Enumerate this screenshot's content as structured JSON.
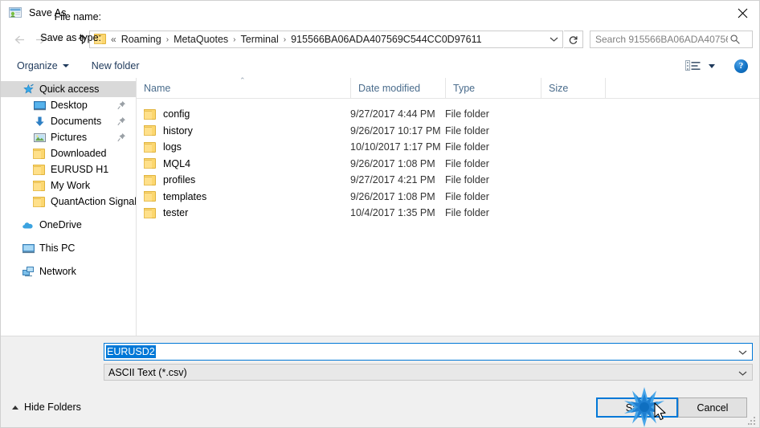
{
  "window": {
    "title": "Save As",
    "app_icon": "save-as-app-icon",
    "close_label": "✕"
  },
  "navigation": {
    "back_icon": "arrow-left-icon",
    "forward_icon": "arrow-right-icon",
    "recent_icon": "chevron-down-icon",
    "up_icon": "arrow-up-icon",
    "address": {
      "folder_icon": "folder-icon",
      "overflow": "«",
      "crumbs": [
        "Roaming",
        "MetaQuotes",
        "Terminal",
        "915566BA06ADA407569C544CC0D97611"
      ],
      "separator": "›",
      "dropdown_icon": "chevron-down-icon"
    },
    "refresh_icon": "refresh-icon",
    "search": {
      "placeholder": "Search 915566BA06ADA40756...",
      "value": "",
      "icon": "search-icon"
    }
  },
  "toolbar": {
    "organize_label": "Organize",
    "new_folder_label": "New folder",
    "view_icon": "list-view-icon",
    "view_dropdown_icon": "chevron-down-icon",
    "help_label": "?",
    "help_icon": "help-icon"
  },
  "sidebar": {
    "items": [
      {
        "label": "Quick access",
        "icon": "star-pin-icon",
        "level": 0,
        "selected": true,
        "pinned": false
      },
      {
        "label": "Desktop",
        "icon": "desktop-icon",
        "level": 1,
        "selected": false,
        "pinned": true
      },
      {
        "label": "Documents",
        "icon": "download-arrow-icon",
        "level": 1,
        "selected": false,
        "pinned": true
      },
      {
        "label": "Pictures",
        "icon": "pictures-icon",
        "level": 1,
        "selected": false,
        "pinned": true
      },
      {
        "label": "Downloaded",
        "icon": "folder-icon",
        "level": 1,
        "selected": false,
        "pinned": false
      },
      {
        "label": "EURUSD H1",
        "icon": "folder-icon",
        "level": 1,
        "selected": false,
        "pinned": false
      },
      {
        "label": "My Work",
        "icon": "folder-icon",
        "level": 1,
        "selected": false,
        "pinned": false
      },
      {
        "label": "QuantAction Signal",
        "icon": "folder-icon",
        "level": 1,
        "selected": false,
        "pinned": false
      },
      {
        "label": "OneDrive",
        "icon": "onedrive-icon",
        "level": 0,
        "selected": false,
        "pinned": false,
        "gap_before": true
      },
      {
        "label": "This PC",
        "icon": "this-pc-icon",
        "level": 0,
        "selected": false,
        "pinned": false,
        "gap_before": true
      },
      {
        "label": "Network",
        "icon": "network-icon",
        "level": 0,
        "selected": false,
        "pinned": false,
        "gap_before": true
      }
    ]
  },
  "file_list": {
    "columns": [
      "Name",
      "Date modified",
      "Type",
      "Size"
    ],
    "sort_column": "Name",
    "sort_indicator": "⌃",
    "rows": [
      {
        "name": "config",
        "icon": "folder-icon",
        "date_modified": "9/27/2017 4:44 PM",
        "type": "File folder",
        "size": ""
      },
      {
        "name": "history",
        "icon": "folder-icon",
        "date_modified": "9/26/2017 10:17 PM",
        "type": "File folder",
        "size": ""
      },
      {
        "name": "logs",
        "icon": "folder-icon",
        "date_modified": "10/10/2017 1:17 PM",
        "type": "File folder",
        "size": ""
      },
      {
        "name": "MQL4",
        "icon": "folder-icon",
        "date_modified": "9/26/2017 1:08 PM",
        "type": "File folder",
        "size": ""
      },
      {
        "name": "profiles",
        "icon": "folder-icon",
        "date_modified": "9/27/2017 4:21 PM",
        "type": "File folder",
        "size": ""
      },
      {
        "name": "templates",
        "icon": "folder-icon",
        "date_modified": "9/26/2017 1:08 PM",
        "type": "File folder",
        "size": ""
      },
      {
        "name": "tester",
        "icon": "folder-icon",
        "date_modified": "10/4/2017 1:35 PM",
        "type": "File folder",
        "size": ""
      }
    ]
  },
  "form": {
    "file_name_label": "File name:",
    "file_name_value": "EURUSD2",
    "file_name_dropdown_icon": "chevron-down-icon",
    "save_as_type_label": "Save as type:",
    "save_as_type_value": "ASCII Text (*.csv)",
    "save_as_type_dropdown_icon": "chevron-down-icon"
  },
  "footer": {
    "hide_folders_label": "Hide Folders",
    "hide_folders_icon": "chevron-up-icon",
    "save_label": "Save",
    "cancel_label": "Cancel",
    "resize_grip_icon": "resize-grip-icon",
    "click_indicator_icon": "click-burst-icon",
    "cursor_icon": "mouse-pointer-icon"
  },
  "colors": {
    "accent": "#0078d7",
    "selection": "#d9d9d9",
    "header_text": "#4a6c8c",
    "toolbar_text": "#1e395b",
    "folder_yellow": "#fcd770",
    "dialog_bg": "#f0f0f0"
  }
}
